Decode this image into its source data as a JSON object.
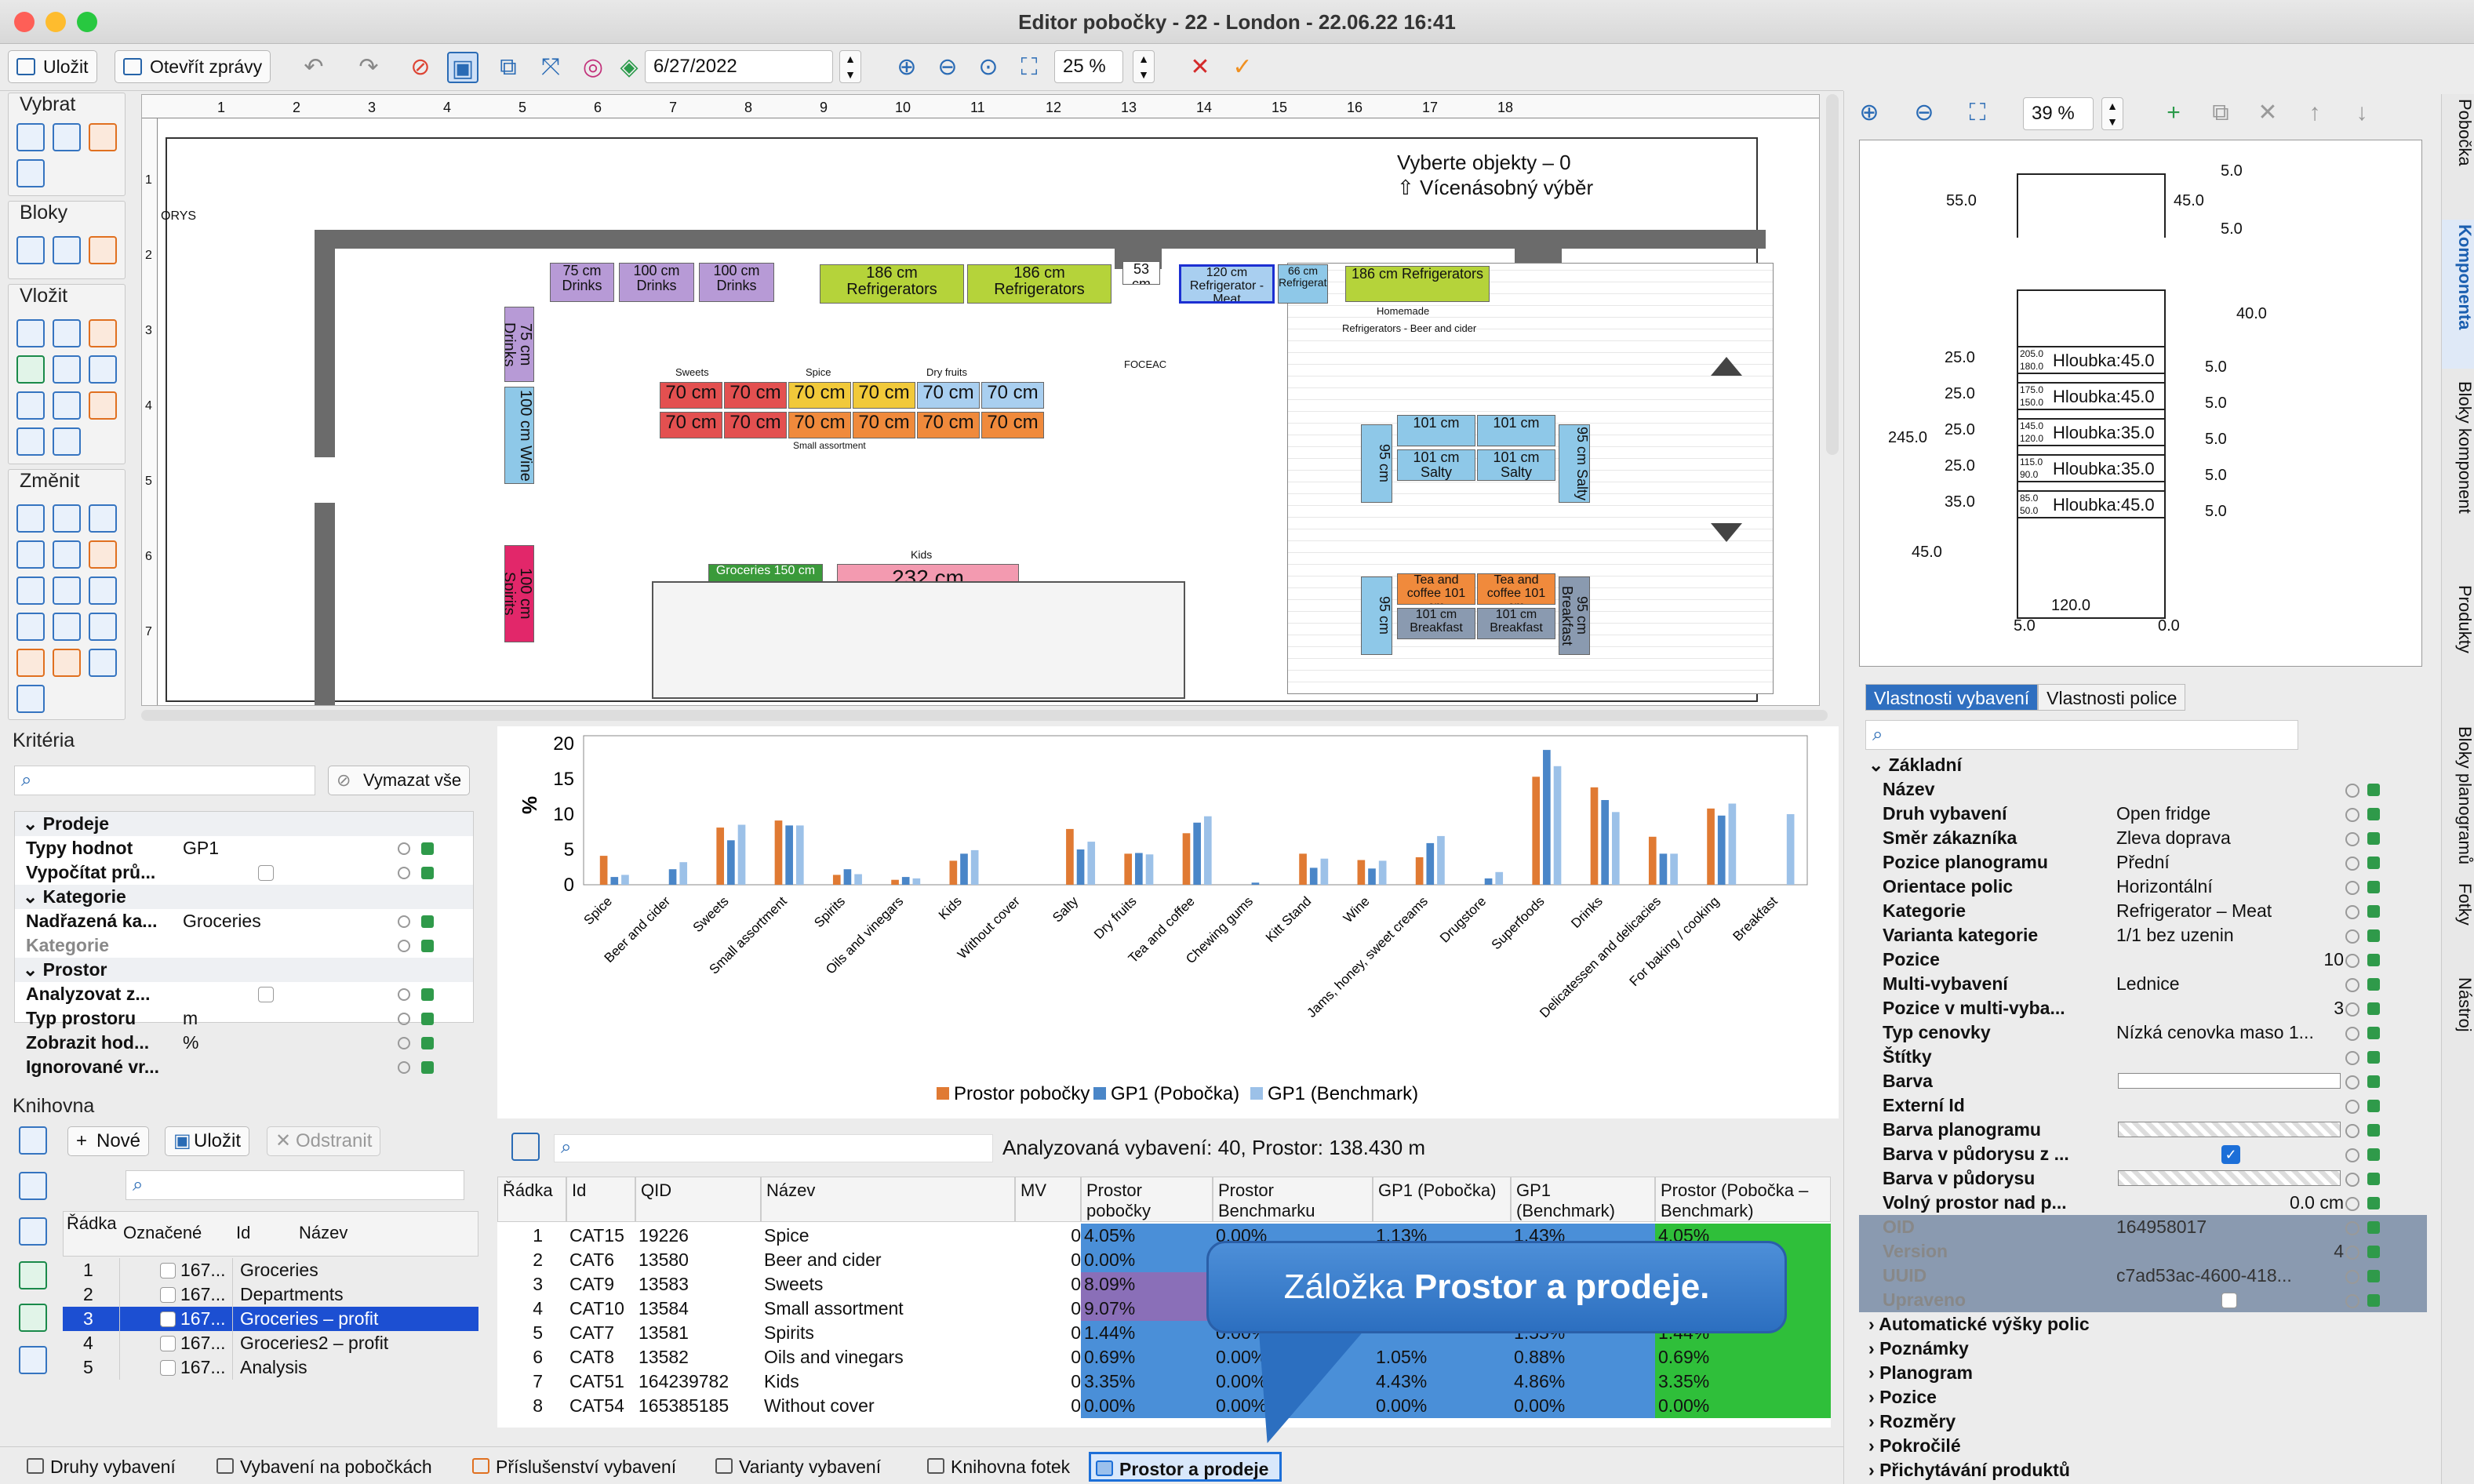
{
  "window": {
    "title": "Editor pobočky - 22 - London - 22.06.22 16:41"
  },
  "toolbar": {
    "save_label": "Uložit",
    "open_reports_label": "Otevřít zprávy",
    "date": "6/27/2022",
    "zoom": "25 %"
  },
  "canvas": {
    "hint_line1": "Vyberte objekty – 0",
    "hint_line2": "Vícenásobný výběr",
    "corner_label": "ORYS",
    "ruler_ticks": [
      "1",
      "2",
      "3",
      "4",
      "5",
      "6",
      "7",
      "8",
      "9",
      "10",
      "11",
      "12",
      "13",
      "14",
      "15",
      "16",
      "17",
      "18"
    ],
    "left_ticks": [
      "1",
      "2",
      "3",
      "4",
      "5",
      "6",
      "7"
    ],
    "fixtures": [
      {
        "label": "75 cm Drinks"
      },
      {
        "label": "100 cm Drinks"
      },
      {
        "label": "100 cm Drinks"
      },
      {
        "label": "186 cm Refrigerators"
      },
      {
        "label": "186 cm Refrigerators"
      },
      {
        "label": "53 cm"
      },
      {
        "label": "120 cm Refrigerator - Meat"
      },
      {
        "label": "66 cm Refrigerato"
      },
      {
        "label": "186 cm Refrigerators"
      },
      {
        "label": "75 cm Drinks"
      },
      {
        "label": "100 cm Wine"
      },
      {
        "label": "100 cm Spirits"
      },
      {
        "label": "70 cm"
      },
      {
        "label": "70 cm"
      },
      {
        "label": "70 cm"
      },
      {
        "label": "70 cm"
      },
      {
        "label": "70 cm"
      },
      {
        "label": "70 cm"
      },
      {
        "label": "70 cm"
      },
      {
        "label": "70 cm"
      },
      {
        "label": "70 cm"
      },
      {
        "label": "70 cm"
      },
      {
        "label": "70 cm"
      },
      {
        "label": "70 cm"
      },
      {
        "label": "Groceries 150 cm"
      },
      {
        "label": "232 cm"
      },
      {
        "label": "101 cm"
      },
      {
        "label": "101 cm Salty"
      },
      {
        "label": "101 cm"
      },
      {
        "label": "101 cm Salty"
      },
      {
        "label": "Tea and coffee 101 cm"
      },
      {
        "label": "Tea and coffee 101 cm"
      },
      {
        "label": "101 cm Breakfast"
      },
      {
        "label": "101 cm Breakfast"
      },
      {
        "label": "95 cm"
      },
      {
        "label": "95 cm Salty"
      },
      {
        "label": "95 cm"
      },
      {
        "label": "95 cm Breakfast"
      }
    ],
    "small_labels": {
      "sweets": "Sweets",
      "spice": "Spice",
      "dryfruits": "Dry fruits",
      "salty": "Salty",
      "kids": "Kids",
      "homemade": "Homemade",
      "beer": "Refrigerators - Beer and cider",
      "baking": "For baking / cooking",
      "deli": "Delicatessen and delicacies",
      "oils": "Oils and vinegars",
      "small": "Small assortment",
      "foceac": "FOCEAC"
    }
  },
  "preview": {
    "zoom": "39 %",
    "dims": {
      "a": "5.0",
      "b": "55.0",
      "c": "45.0",
      "d": "5.0",
      "e": "40.0",
      "f": "245.0",
      "g": "45.0",
      "h": "120.0",
      "i": "5.0",
      "j": "0.0"
    },
    "left_dims": [
      "25.0",
      "25.0",
      "25.0",
      "25.0",
      "35.0"
    ],
    "right_dims": [
      "5.0",
      "5.0",
      "5.0",
      "5.0",
      "5.0"
    ],
    "shelves": [
      {
        "top": "205.0",
        "bottom": "180.0",
        "label": "Hloubka:45.0"
      },
      {
        "top": "175.0",
        "bottom": "150.0",
        "label": "Hloubka:45.0"
      },
      {
        "top": "145.0",
        "bottom": "120.0",
        "label": "Hloubka:35.0"
      },
      {
        "top": "115.0",
        "bottom": "90.0",
        "label": "Hloubka:35.0"
      },
      {
        "top": "85.0",
        "bottom": "50.0",
        "label": "Hloubka:45.0"
      }
    ]
  },
  "props": {
    "tabs": [
      "Vlastnosti vybavení",
      "Vlastnosti police"
    ],
    "sections": {
      "basic": "Základní"
    },
    "rows": [
      {
        "k": "Název",
        "v": ""
      },
      {
        "k": "Druh vybavení",
        "v": "Open fridge"
      },
      {
        "k": "Směr zákazníka",
        "v": "Zleva doprava"
      },
      {
        "k": "Pozice planogramu",
        "v": "Přední"
      },
      {
        "k": "Orientace polic",
        "v": "Horizontální"
      },
      {
        "k": "Kategorie",
        "v": "Refrigerator – Meat"
      },
      {
        "k": "Varianta kategorie",
        "v": "1/1 bez uzenin"
      },
      {
        "k": "Pozice",
        "v": "10"
      },
      {
        "k": "Multi-vybavení",
        "v": "Lednice"
      },
      {
        "k": "Pozice v multi-vyba...",
        "v": "3"
      },
      {
        "k": "Typ cenovky",
        "v": "Nízká cenovka maso 1..."
      },
      {
        "k": "Štítky",
        "v": ""
      },
      {
        "k": "Barva",
        "v": ""
      },
      {
        "k": "Externí Id",
        "v": ""
      },
      {
        "k": "Barva planogramu",
        "v": ""
      },
      {
        "k": "Barva v půdorysu z ...",
        "v": ""
      },
      {
        "k": "Barva v půdorysu",
        "v": ""
      },
      {
        "k": "Volný prostor nad p...",
        "v": "0.0 cm"
      }
    ],
    "grey_rows": [
      {
        "k": "OID",
        "v": "164958017"
      },
      {
        "k": "Version",
        "v": "4"
      },
      {
        "k": "UUID",
        "v": "c7ad53ac-4600-418..."
      },
      {
        "k": "Upraveno",
        "v": ""
      }
    ],
    "collapsed": [
      "Automatické výšky polic",
      "Poznámky",
      "Planogram",
      "Pozice",
      "Rozměry",
      "Pokročilé",
      "Přichytávání produktů"
    ]
  },
  "side_tabs": [
    "Pobočka",
    "Komponenta",
    "Bloky komponent",
    "Produkty",
    "Bloky planogramů",
    "Fotky",
    "Nástroj"
  ],
  "left_toolbox": {
    "select": "Vybrat",
    "blocks": "Bloky",
    "insert": "Vložit",
    "change": "Změnit"
  },
  "criteria": {
    "title": "Kritéria",
    "clear_all": "Vymazat vše",
    "rows": [
      {
        "k": "Prodeje",
        "v": "",
        "sec": true
      },
      {
        "k": "Typy hodnot",
        "v": "GP1"
      },
      {
        "k": "Vypočítat prů...",
        "v": ""
      },
      {
        "k": "Kategorie",
        "v": "",
        "sec": true
      },
      {
        "k": "Nadřazená ka...",
        "v": "Groceries"
      },
      {
        "k": "Kategorie",
        "v": "",
        "grey": true
      },
      {
        "k": "Prostor",
        "v": "",
        "sec": true
      },
      {
        "k": "Analyzovat z...",
        "v": ""
      },
      {
        "k": "Typ prostoru",
        "v": "m"
      },
      {
        "k": "Zobrazit hod...",
        "v": "%"
      },
      {
        "k": "Ignorované vr...",
        "v": ""
      }
    ]
  },
  "library": {
    "title": "Knihovna",
    "new": "Nové",
    "save": "Uložit",
    "delete": "Odstranit",
    "cols": [
      "Řádka",
      "Označené",
      "Id",
      "Název"
    ],
    "rows": [
      {
        "n": "1",
        "id": "167...",
        "name": "Groceries"
      },
      {
        "n": "2",
        "id": "167...",
        "name": "Departments"
      },
      {
        "n": "3",
        "id": "167...",
        "name": "Groceries – profit"
      },
      {
        "n": "4",
        "id": "167...",
        "name": "Groceries2 – profit"
      },
      {
        "n": "5",
        "id": "167...",
        "name": "Analysis"
      }
    ]
  },
  "chart_data": {
    "type": "bar",
    "ylabel": "%",
    "ylim": [
      0,
      20
    ],
    "yticks": [
      "0",
      "5",
      "10",
      "15",
      "20"
    ],
    "categories": [
      "Spice",
      "Beer and cider",
      "Sweets",
      "Small assortment",
      "Spirits",
      "Oils and vinegars",
      "Kids",
      "Without cover",
      "Salty",
      "Dry fruits",
      "Tea and coffee",
      "Chewing gums",
      "Kitt Stand",
      "Wine",
      "Jams, honey, sweet creams",
      "Drugstore",
      "Superfoods",
      "Drinks",
      "Delicatessen and delicacies",
      "For baking / cooking",
      "Breakfast"
    ],
    "series": [
      {
        "name": "Prostor pobočky",
        "color": "#e07a33",
        "values": [
          4.1,
          0.0,
          8.1,
          9.1,
          1.4,
          0.7,
          3.4,
          0.0,
          7.9,
          4.4,
          7.3,
          0.0,
          4.4,
          3.5,
          3.9,
          0.0,
          15.3,
          13.8,
          6.8,
          10.8,
          0.0
        ]
      },
      {
        "name": "GP1 (Pobočka)",
        "color": "#4a86c8",
        "values": [
          1.1,
          2.2,
          6.3,
          8.4,
          2.2,
          1.1,
          4.4,
          0.0,
          5.0,
          4.5,
          8.8,
          0.3,
          2.4,
          2.3,
          5.9,
          0.9,
          19.1,
          12.0,
          4.4,
          9.8,
          0.0
        ]
      },
      {
        "name": "GP1 (Benchmark)",
        "color": "#9cc1e8",
        "values": [
          1.4,
          3.2,
          8.5,
          8.4,
          1.5,
          0.9,
          4.9,
          0.0,
          6.1,
          4.3,
          9.7,
          0.0,
          3.7,
          3.4,
          6.9,
          1.8,
          16.8,
          10.3,
          4.4,
          11.5,
          10.0
        ]
      }
    ]
  },
  "table": {
    "search_status": "Analyzovaná vybavení: 40, Prostor: 138.430 m",
    "cols": [
      "Řádka",
      "Id",
      "QID",
      "Název",
      "MV",
      "Prostor pobočky",
      "Prostor Benchmarku",
      "GP1 (Pobočka)",
      "GP1 (Benchmark)",
      "Prostor (Pobočka – Benchmark)"
    ],
    "rows": [
      {
        "n": "1",
        "id": "CAT15",
        "qid": "19226",
        "name": "Spice",
        "mv": "0",
        "pp": "4.05%",
        "pb": "0.00%",
        "gp": "1.13%",
        "gb": "1.43%",
        "d": "4.05%"
      },
      {
        "n": "2",
        "id": "CAT6",
        "qid": "13580",
        "name": "Beer and cider",
        "mv": "0",
        "pp": "0.00%",
        "pb": "",
        "gp": "",
        "gb": "",
        "d": ""
      },
      {
        "n": "3",
        "id": "CAT9",
        "qid": "13583",
        "name": "Sweets",
        "mv": "0",
        "pp": "8.09%",
        "pb": "",
        "gp": "",
        "gb": "",
        "d": ""
      },
      {
        "n": "4",
        "id": "CAT10",
        "qid": "13584",
        "name": "Small assortment",
        "mv": "0",
        "pp": "9.07%",
        "pb": "",
        "gp": "",
        "gb": "",
        "d": ""
      },
      {
        "n": "5",
        "id": "CAT7",
        "qid": "13581",
        "name": "Spirits",
        "mv": "0",
        "pp": "1.44%",
        "pb": "0.00%",
        "gp": "",
        "gb": "1.55%",
        "d": "1.44%"
      },
      {
        "n": "6",
        "id": "CAT8",
        "qid": "13582",
        "name": "Oils and vinegars",
        "mv": "0",
        "pp": "0.69%",
        "pb": "0.00%",
        "gp": "1.05%",
        "gb": "0.88%",
        "d": "0.69%"
      },
      {
        "n": "7",
        "id": "CAT51",
        "qid": "164239782",
        "name": "Kids",
        "mv": "0",
        "pp": "3.35%",
        "pb": "0.00%",
        "gp": "4.43%",
        "gb": "4.86%",
        "d": "3.35%"
      },
      {
        "n": "8",
        "id": "CAT54",
        "qid": "165385185",
        "name": "Without cover",
        "mv": "0",
        "pp": "0.00%",
        "pb": "0.00%",
        "gp": "0.00%",
        "gb": "0.00%",
        "d": "0.00%"
      }
    ]
  },
  "callout": {
    "prefix": "Záložka ",
    "bold": "Prostor a prodeje."
  },
  "bottom_tabs": [
    "Druhy vybavení",
    "Vybavení na pobočkách",
    "Příslušenství vybavení",
    "Varianty vybavení",
    "Knihovna fotek",
    "Prostor a prodeje"
  ]
}
